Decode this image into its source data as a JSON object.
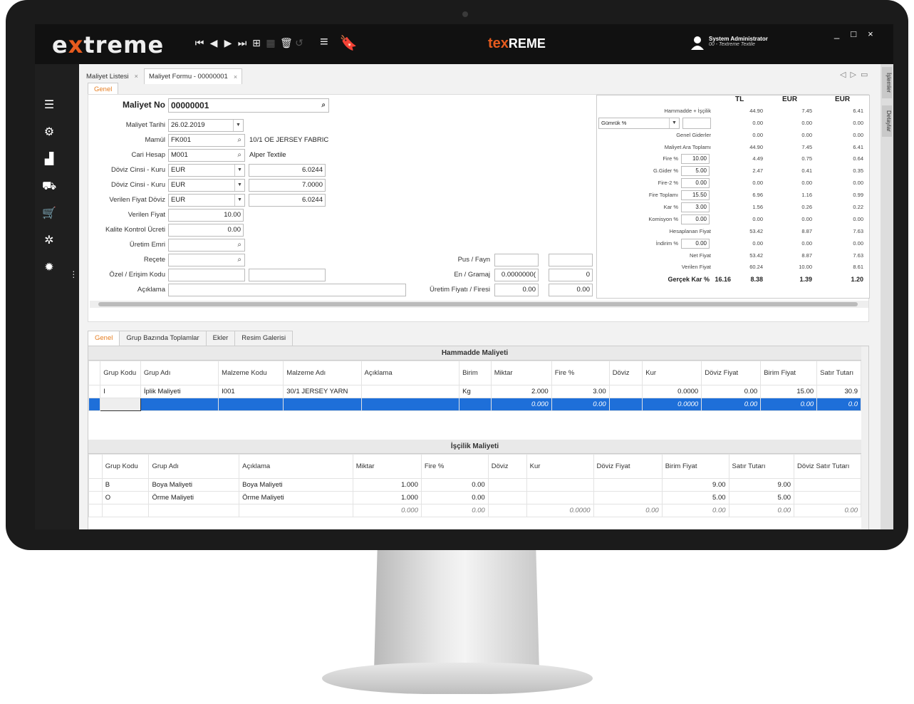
{
  "topbar": {
    "logo_prefix": "e",
    "logo_x": "x",
    "logo_suffix": "treme",
    "brand_tex": "tex",
    "brand_reme": "REME",
    "user_name": "System Administrator",
    "user_company": "00 - Textreme Textile",
    "nav_icons": [
      "first-icon",
      "prev-icon",
      "next-icon",
      "last-icon",
      "new-icon",
      "save-icon",
      "delete-icon",
      "undo-icon"
    ],
    "win_min": "_",
    "win_max": "□",
    "win_close": "×"
  },
  "doc_tabs": [
    {
      "label": "Maliyet Listesi",
      "close": "×"
    },
    {
      "label": "Maliyet Formu - 00000001",
      "close": "×"
    }
  ],
  "right_tabs": [
    "İşlemler",
    "Detaylar"
  ],
  "form_tab": "Genel",
  "form": {
    "maliyet_no_label": "Maliyet No",
    "maliyet_no": "00000001",
    "maliyet_tarihi_label": "Maliyet Tarihi",
    "maliyet_tarihi": "26.02.2019",
    "mamul_label": "Mamül",
    "mamul": "FK001",
    "mamul_desc": "10/1 OE JERSEY FABRIC",
    "cari_label": "Cari Hesap",
    "cari": "M001",
    "cari_desc": "Alper Textile",
    "doviz1_label": "Döviz Cinsi - Kuru",
    "doviz1": "EUR",
    "doviz1_rate": "6.0244",
    "doviz2_label": "Döviz Cinsi - Kuru",
    "doviz2": "EUR",
    "doviz2_rate": "7.0000",
    "verilen_doviz_label": "Verilen Fiyat Döviz",
    "verilen_doviz": "EUR",
    "verilen_doviz_rate": "6.0244",
    "verilen_fiyat_label": "Verilen Fiyat",
    "verilen_fiyat": "10.00",
    "kalite_label": "Kalite Kontrol Ücreti",
    "kalite": "0.00",
    "uretim_emri_label": "Üretim Emri",
    "recete_label": "Reçete",
    "ozel_label": "Özel / Erişim Kodu",
    "aciklama_label": "Açıklama",
    "pus_label": "Pus / Fayn",
    "en_label": "En / Gramaj",
    "en_value": "0.0000000(",
    "gramaj_value": "0",
    "uretim_fiyat_label": "Üretim Fiyatı / Firesi",
    "uretim_fiyat": "0.00",
    "uretim_fire": "0.00"
  },
  "summary": {
    "headers": [
      "TL",
      "EUR",
      "EUR"
    ],
    "gumruk_label": "Gümrük %",
    "rows": [
      {
        "label": "Hammadde + İşçilik",
        "tl": "44.90",
        "eur1": "7.45",
        "eur2": "6.41"
      },
      {
        "label": "",
        "tl": "0.00",
        "eur1": "0.00",
        "eur2": "0.00"
      },
      {
        "label": "Genel Giderler",
        "tl": "0.00",
        "eur1": "0.00",
        "eur2": "0.00"
      },
      {
        "label": "Maliyet Ara Toplamı",
        "tl": "44.90",
        "eur1": "7.45",
        "eur2": "6.41"
      },
      {
        "label": "Fire %",
        "input": "10.00",
        "tl": "4.49",
        "eur1": "0.75",
        "eur2": "0.64"
      },
      {
        "label": "G.Gider %",
        "input": "5.00",
        "tl": "2.47",
        "eur1": "0.41",
        "eur2": "0.35"
      },
      {
        "label": "Fire-2 %",
        "input": "0.00",
        "tl": "0.00",
        "eur1": "0.00",
        "eur2": "0.00"
      },
      {
        "label": "Fire Toplamı",
        "input": "15.50",
        "tl": "6.96",
        "eur1": "1.16",
        "eur2": "0.99"
      },
      {
        "label": "Kar %",
        "input": "3.00",
        "tl": "1.56",
        "eur1": "0.26",
        "eur2": "0.22"
      },
      {
        "label": "Komisyon %",
        "input": "0.00",
        "tl": "0.00",
        "eur1": "0.00",
        "eur2": "0.00"
      },
      {
        "label": "Hesaplanan Fiyat",
        "tl": "53.42",
        "eur1": "8.87",
        "eur2": "7.63"
      },
      {
        "label": "İndirim %",
        "input": "0.00",
        "tl": "0.00",
        "eur1": "0.00",
        "eur2": "0.00"
      },
      {
        "label": "Net Fiyat",
        "tl": "53.42",
        "eur1": "8.87",
        "eur2": "7.63"
      },
      {
        "label": "Verilen Fiyat",
        "tl": "60.24",
        "eur1": "10.00",
        "eur2": "8.61"
      }
    ],
    "gercek_label": "Gerçek Kar %",
    "gercek_pct": "16.16",
    "gercek_tl": "8.38",
    "gercek_eur1": "1.39",
    "gercek_eur2": "1.20"
  },
  "lower_tabs": [
    "Genel",
    "Grup Bazında Toplamlar",
    "Ekler",
    "Resim Galerisi"
  ],
  "hammadde": {
    "title": "Hammadde Maliyeti",
    "columns": [
      "Grup Kodu",
      "Grup Adı",
      "Malzeme Kodu",
      "Malzeme Adı",
      "Açıklama",
      "Birim",
      "Miktar",
      "Fire %",
      "Döviz",
      "Kur",
      "Döviz Fiyat",
      "Birim Fiyat",
      "Satır Tutarı"
    ],
    "rows": [
      [
        "I",
        "İplik Maliyeti",
        "I001",
        "30/1 JERSEY YARN",
        "",
        "Kg",
        "2.000",
        "3.00",
        "",
        "0.0000",
        "0.00",
        "15.00",
        "30.9"
      ]
    ],
    "total": [
      "",
      "",
      "",
      "",
      "",
      "",
      "0.000",
      "0.00",
      "",
      "0.0000",
      "0.00",
      "0.00",
      "0.0"
    ]
  },
  "iscilik": {
    "title": "İşçilik Maliyeti",
    "columns": [
      "Grup Kodu",
      "Grup Adı",
      "Açıklama",
      "Miktar",
      "Fire %",
      "Döviz",
      "Kur",
      "Döviz Fiyat",
      "Birim Fiyat",
      "Satır Tutarı",
      "Döviz Satır Tutarı"
    ],
    "rows": [
      [
        "B",
        "Boya Maliyeti",
        "Boya Maliyeti",
        "1.000",
        "0.00",
        "",
        "",
        "",
        "9.00",
        "9.00",
        ""
      ],
      [
        "O",
        "Örme Maliyeti",
        "Örme Maliyeti",
        "1.000",
        "0.00",
        "",
        "",
        "",
        "5.00",
        "5.00",
        ""
      ]
    ],
    "total": [
      "",
      "",
      "",
      "0.000",
      "0.00",
      "",
      "0.0000",
      "0.00",
      "0.00",
      "0.00",
      "0.00"
    ]
  }
}
